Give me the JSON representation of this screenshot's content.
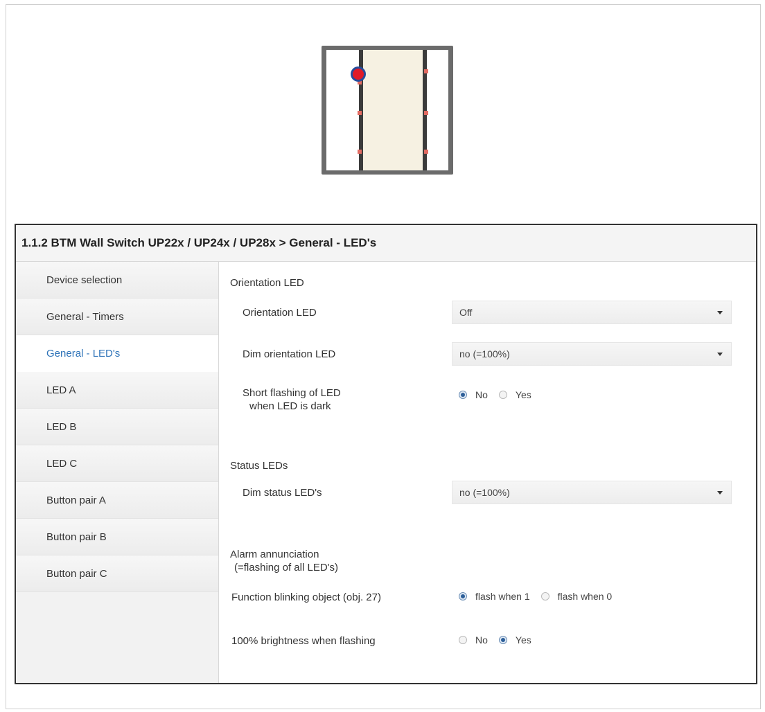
{
  "dialog": {
    "title": "1.1.2 BTM Wall Switch UP22x / UP24x / UP28x > General - LED's"
  },
  "sidebar": {
    "items": [
      {
        "label": "Device selection",
        "active": false
      },
      {
        "label": "General - Timers",
        "active": false
      },
      {
        "label": "General - LED's",
        "active": true
      },
      {
        "label": "LED A",
        "active": false
      },
      {
        "label": "LED B",
        "active": false
      },
      {
        "label": "LED C",
        "active": false
      },
      {
        "label": "Button pair A",
        "active": false
      },
      {
        "label": "Button pair B",
        "active": false
      },
      {
        "label": "Button pair C",
        "active": false
      }
    ]
  },
  "orientation": {
    "section_title": "Orientation LED",
    "orientation_led_label": "Orientation LED",
    "orientation_led_value": "Off",
    "dim_label": "Dim orientation LED",
    "dim_value": "no (=100%)",
    "flash_label_line1": "Short flashing of LED",
    "flash_label_line2": "when LED is dark",
    "flash_options": [
      "No",
      "Yes"
    ],
    "flash_selected": "No"
  },
  "status": {
    "section_title": "Status LEDs",
    "dim_label": "Dim status LED's",
    "dim_value": "no (=100%)"
  },
  "alarm": {
    "section_title_line1": "Alarm annunciation",
    "section_title_line2": "(=flashing of all LED's)",
    "blink_label": "Function blinking object (obj. 27)",
    "blink_options": [
      "flash when 1",
      "flash when 0"
    ],
    "blink_selected": "flash when 1",
    "brightness_label": "100% brightness when flashing",
    "brightness_options": [
      "No",
      "Yes"
    ],
    "brightness_selected": "Yes"
  },
  "colors": {
    "active_nav_text": "#2e73b8",
    "led_indicator_fill": "#e11a27",
    "led_indicator_ring": "#274c9b"
  }
}
